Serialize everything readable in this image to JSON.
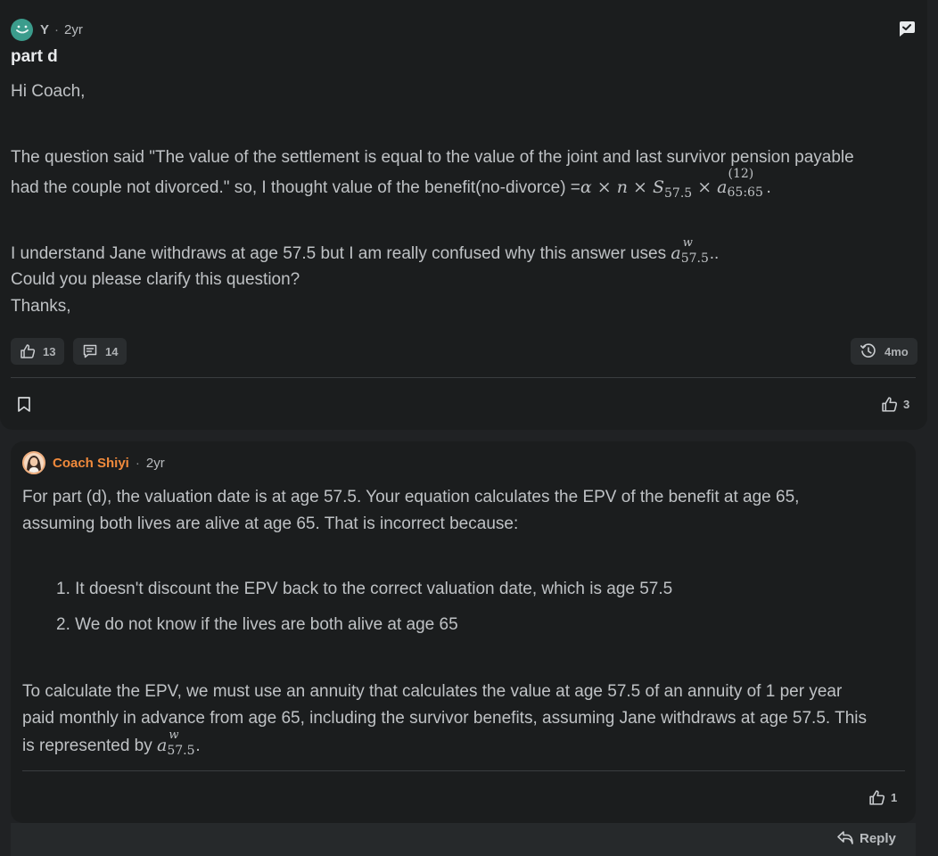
{
  "post": {
    "author": "Y",
    "time": "2yr",
    "title": "part d",
    "greeting": "Hi Coach,",
    "para1_line1": "The question said \"The value of the settlement is equal to the value of the joint and last survivor pension payable",
    "para1_line2_text": "had the couple not divorced.\" so, I thought value of the benefit(no-divorce) =",
    "para1_line2_math": "α × n × S",
    "para1_line2_sub": "57.5",
    "para1_line2_times": " × a",
    "para1_line2_sup": "(12)",
    "para1_line2_sub2": "65:65",
    "para1_line2_end": ".",
    "para2_text": "I understand Jane withdraws at age 57.5 but I am really confused why this answer uses ",
    "para2_math": "a",
    "para2_sup": "w",
    "para2_sub": "57.5",
    "para2_end": "..",
    "line3": "Could you please clarify this question?",
    "line4": "Thanks,",
    "likes": "13",
    "comments": "14",
    "history": "4mo",
    "answer_likes": "3"
  },
  "reply": {
    "author": "Coach Shiyi",
    "time": "2yr",
    "para1_line1": "For part (d), the valuation date is at age 57.5. Your equation calculates the EPV of the benefit at age 65,",
    "para1_line2": "assuming both lives are alive at age 65. That is incorrect because:",
    "list": [
      "1. It doesn't discount the EPV back to the correct valuation date, which is age 57.5",
      "2. We do not know if the lives are both alive at age 65"
    ],
    "para2_line1": "To calculate the EPV, we must use an annuity that calculates the value at age 57.5 of an annuity of 1 per year",
    "para2_line2": "paid monthly in advance from age 65, including the survivor benefits, assuming Jane withdraws at age 57.5. This",
    "para2_line3_text": "is represented by ",
    "para2_math": "a",
    "para2_sup": "w",
    "para2_sub": "57.5",
    "para2_end": ".",
    "likes": "1",
    "reply_label": "Reply"
  },
  "colors": {
    "accent_coach": "#f08a3c",
    "avatar_y": "#3b9c8c"
  }
}
